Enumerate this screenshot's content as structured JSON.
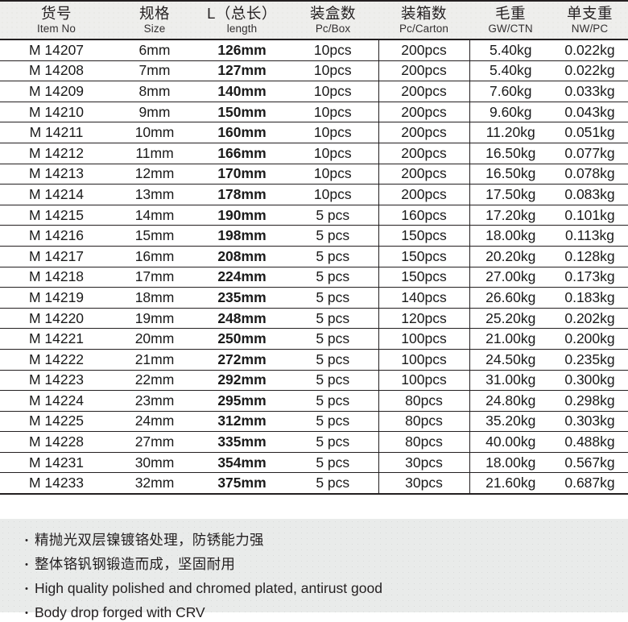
{
  "table": {
    "columns": [
      {
        "cn": "货号",
        "en": "Item No",
        "key": "item_no"
      },
      {
        "cn": "规格",
        "en": "Size",
        "key": "size"
      },
      {
        "cn": "L（总长）",
        "en": "length",
        "key": "length"
      },
      {
        "cn": "装盒数",
        "en": "Pc/Box",
        "key": "pc_box"
      },
      {
        "cn": "装箱数",
        "en": "Pc/Carton",
        "key": "pc_carton"
      },
      {
        "cn": "毛重",
        "en": "GW/CTN",
        "key": "gw_ctn"
      },
      {
        "cn": "单支重",
        "en": "NW/PC",
        "key": "nw_pc"
      }
    ],
    "rows": [
      {
        "item_no": "M 14207",
        "size": "6mm",
        "length": "126mm",
        "pc_box": "10pcs",
        "pc_carton": "200pcs",
        "gw_ctn": "5.40kg",
        "nw_pc": "0.022kg"
      },
      {
        "item_no": "M 14208",
        "size": "7mm",
        "length": "127mm",
        "pc_box": "10pcs",
        "pc_carton": "200pcs",
        "gw_ctn": "5.40kg",
        "nw_pc": "0.022kg"
      },
      {
        "item_no": "M 14209",
        "size": "8mm",
        "length": "140mm",
        "pc_box": "10pcs",
        "pc_carton": "200pcs",
        "gw_ctn": "7.60kg",
        "nw_pc": "0.033kg"
      },
      {
        "item_no": "M 14210",
        "size": "9mm",
        "length": "150mm",
        "pc_box": "10pcs",
        "pc_carton": "200pcs",
        "gw_ctn": "9.60kg",
        "nw_pc": "0.043kg"
      },
      {
        "item_no": "M 14211",
        "size": "10mm",
        "length": "160mm",
        "pc_box": "10pcs",
        "pc_carton": "200pcs",
        "gw_ctn": "11.20kg",
        "nw_pc": "0.051kg"
      },
      {
        "item_no": "M 14212",
        "size": "11mm",
        "length": "166mm",
        "pc_box": "10pcs",
        "pc_carton": "200pcs",
        "gw_ctn": "16.50kg",
        "nw_pc": "0.077kg"
      },
      {
        "item_no": "M 14213",
        "size": "12mm",
        "length": "170mm",
        "pc_box": "10pcs",
        "pc_carton": "200pcs",
        "gw_ctn": "16.50kg",
        "nw_pc": "0.078kg"
      },
      {
        "item_no": "M 14214",
        "size": "13mm",
        "length": "178mm",
        "pc_box": "10pcs",
        "pc_carton": "200pcs",
        "gw_ctn": "17.50kg",
        "nw_pc": "0.083kg"
      },
      {
        "item_no": "M 14215",
        "size": "14mm",
        "length": "190mm",
        "pc_box": "5 pcs",
        "pc_carton": "160pcs",
        "gw_ctn": "17.20kg",
        "nw_pc": "0.101kg"
      },
      {
        "item_no": "M 14216",
        "size": "15mm",
        "length": "198mm",
        "pc_box": "5 pcs",
        "pc_carton": "150pcs",
        "gw_ctn": "18.00kg",
        "nw_pc": "0.113kg"
      },
      {
        "item_no": "M 14217",
        "size": "16mm",
        "length": "208mm",
        "pc_box": "5 pcs",
        "pc_carton": "150pcs",
        "gw_ctn": "20.20kg",
        "nw_pc": "0.128kg"
      },
      {
        "item_no": "M 14218",
        "size": "17mm",
        "length": "224mm",
        "pc_box": "5 pcs",
        "pc_carton": "150pcs",
        "gw_ctn": "27.00kg",
        "nw_pc": "0.173kg"
      },
      {
        "item_no": "M 14219",
        "size": "18mm",
        "length": "235mm",
        "pc_box": "5 pcs",
        "pc_carton": "140pcs",
        "gw_ctn": "26.60kg",
        "nw_pc": "0.183kg"
      },
      {
        "item_no": "M 14220",
        "size": "19mm",
        "length": "248mm",
        "pc_box": "5 pcs",
        "pc_carton": "120pcs",
        "gw_ctn": "25.20kg",
        "nw_pc": "0.202kg"
      },
      {
        "item_no": "M 14221",
        "size": "20mm",
        "length": "250mm",
        "pc_box": "5 pcs",
        "pc_carton": "100pcs",
        "gw_ctn": "21.00kg",
        "nw_pc": "0.200kg"
      },
      {
        "item_no": "M 14222",
        "size": "21mm",
        "length": "272mm",
        "pc_box": "5 pcs",
        "pc_carton": "100pcs",
        "gw_ctn": "24.50kg",
        "nw_pc": "0.235kg"
      },
      {
        "item_no": "M 14223",
        "size": "22mm",
        "length": "292mm",
        "pc_box": "5 pcs",
        "pc_carton": "100pcs",
        "gw_ctn": "31.00kg",
        "nw_pc": "0.300kg"
      },
      {
        "item_no": "M 14224",
        "size": "23mm",
        "length": "295mm",
        "pc_box": "5 pcs",
        "pc_carton": "80pcs",
        "gw_ctn": "24.80kg",
        "nw_pc": "0.298kg"
      },
      {
        "item_no": "M 14225",
        "size": "24mm",
        "length": "312mm",
        "pc_box": "5 pcs",
        "pc_carton": "80pcs",
        "gw_ctn": "35.20kg",
        "nw_pc": "0.303kg"
      },
      {
        "item_no": "M 14228",
        "size": "27mm",
        "length": "335mm",
        "pc_box": "5 pcs",
        "pc_carton": "80pcs",
        "gw_ctn": "40.00kg",
        "nw_pc": "0.488kg"
      },
      {
        "item_no": "M 14231",
        "size": "30mm",
        "length": "354mm",
        "pc_box": "5 pcs",
        "pc_carton": "30pcs",
        "gw_ctn": "18.00kg",
        "nw_pc": "0.567kg"
      },
      {
        "item_no": "M 14233",
        "size": "32mm",
        "length": "375mm",
        "pc_box": "5 pcs",
        "pc_carton": "30pcs",
        "gw_ctn": "21.60kg",
        "nw_pc": "0.687kg"
      }
    ]
  },
  "notes": {
    "bullet": "・",
    "lines": [
      {
        "text": "精抛光双层镍镀铬处理，防锈能力强",
        "lang": "cn"
      },
      {
        "text": "整体铬钒钢锻造而成，坚固耐用",
        "lang": "cn"
      },
      {
        "text": "High quality polished and chromed plated, antirust good",
        "lang": "en"
      },
      {
        "text": "Body drop forged with CRV",
        "lang": "en"
      }
    ]
  },
  "colors": {
    "rule": "#231f20",
    "header_bg": "#eeeeec",
    "notes_bg": "#e9ebea",
    "text": "#1a1a1a"
  }
}
